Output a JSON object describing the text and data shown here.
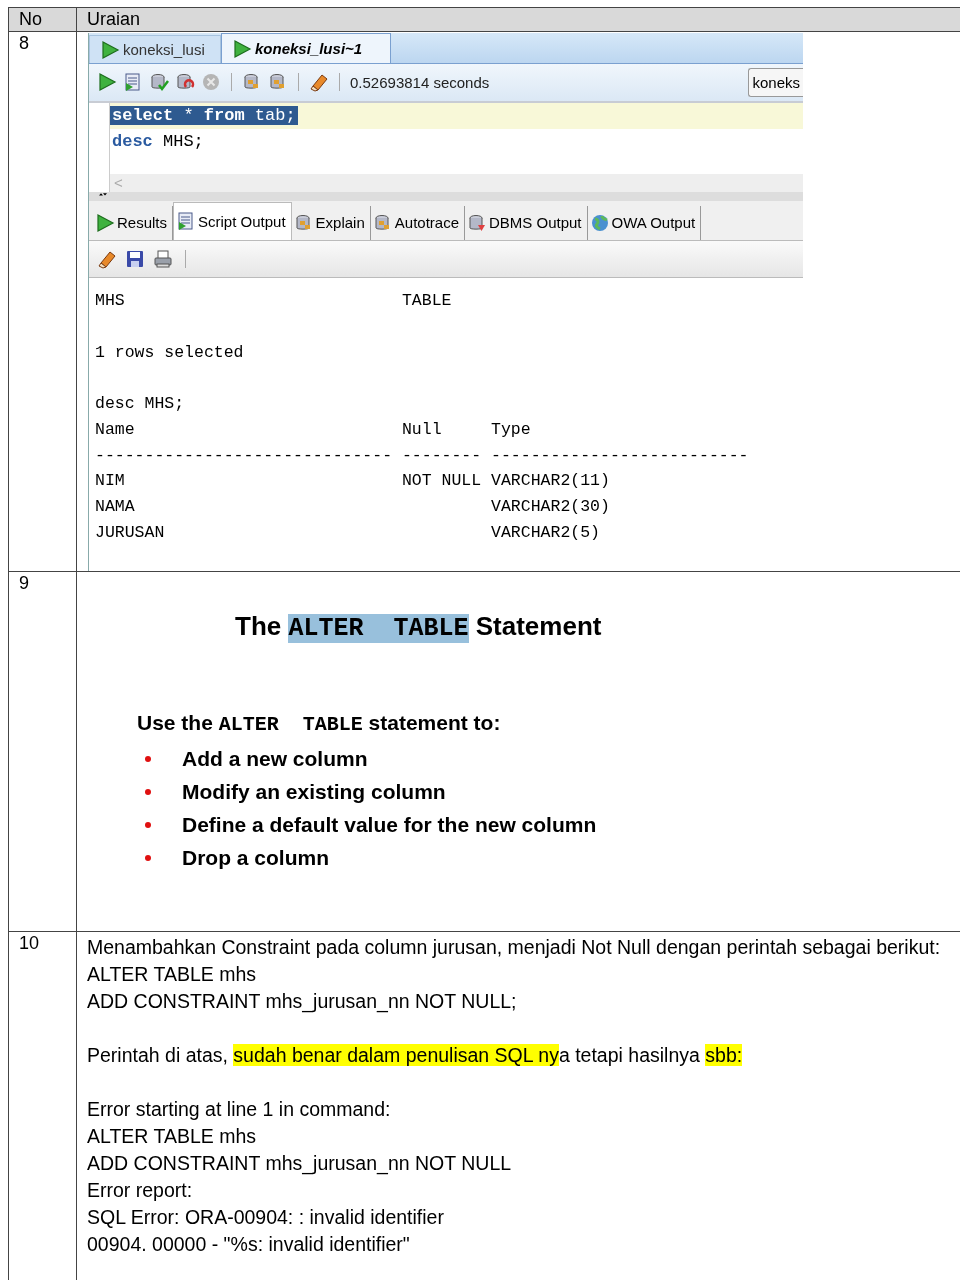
{
  "table": {
    "columns": [
      "No",
      "Uraian"
    ],
    "rows": [
      {
        "no": "8",
        "content": {
          "kind": "sql_developer",
          "doc_tabs": [
            {
              "label": "koneksi_lusi",
              "selected": false
            },
            {
              "label": "koneksi_lusi~1",
              "selected": true
            }
          ],
          "status": "0.52693814 seconds",
          "connection": "koneks",
          "editor_lines": [
            {
              "selected": true,
              "tokens": [
                {
                  "text": "select",
                  "kind": "keyword"
                },
                {
                  "text": " * ",
                  "kind": "plain"
                },
                {
                  "text": "from",
                  "kind": "keyword"
                },
                {
                  "text": " tab;",
                  "kind": "plain"
                }
              ]
            },
            {
              "selected": false,
              "tokens": [
                {
                  "text": "desc",
                  "kind": "keyword"
                },
                {
                  "text": " MHS;",
                  "kind": "plain"
                }
              ]
            }
          ],
          "scroll_glyph": "<",
          "output_tabs": [
            {
              "label": "Results",
              "selected": false
            },
            {
              "label": "Script Output",
              "selected": true
            },
            {
              "label": "Explain",
              "selected": false
            },
            {
              "label": "Autotrace",
              "selected": false
            },
            {
              "label": "DBMS Output",
              "selected": false
            },
            {
              "label": "OWA Output",
              "selected": false
            }
          ],
          "output_blocks": [
            [
              "MHS                            TABLE"
            ],
            [
              "1 rows selected"
            ],
            [
              "desc MHS;",
              "Name                           Null     Type",
              "------------------------------ -------- --------------------------",
              "NIM                            NOT NULL VARCHAR2(11)",
              "NAMA                                    VARCHAR2(30)",
              "JURUSAN                                 VARCHAR2(5)"
            ]
          ]
        }
      },
      {
        "no": "9",
        "content": {
          "kind": "slide",
          "title": {
            "before": "The",
            "code": "ALTER  TABLE",
            "after": "Statement"
          },
          "intro": {
            "before": "Use the",
            "code": "ALTER  TABLE",
            "after": "statement to:"
          },
          "bullets": [
            "Add a new column",
            "Modify an existing column",
            "Define a default value for the new column",
            "Drop a column"
          ]
        }
      },
      {
        "no": "10",
        "content": {
          "kind": "text",
          "blocks": [
            [
              "Menambahkan Constraint pada column jurusan, menjadi Not Null dengan perintah sebagai berikut:",
              "ALTER TABLE mhs",
              "ADD CONSTRAINT mhs_jurusan_nn NOT NULL;"
            ],
            [
              [
                {
                  "text": "Perintah di atas, ",
                  "highlighted": false
                },
                {
                  "text": "sudah benar dalam penulisan SQL ny",
                  "highlighted": true
                },
                {
                  "text": "a tetapi hasilnya ",
                  "highlighted": false
                },
                {
                  "text": "sbb:",
                  "highlighted": true
                }
              ]
            ],
            [
              "Error starting at line 1 in command:",
              "ALTER TABLE mhs",
              "ADD CONSTRAINT mhs_jurusan_nn NOT NULL",
              "Error report:",
              "SQL Error: ORA-00904: : invalid identifier",
              "00904. 00000 -  \"%s: invalid identifier\""
            ]
          ]
        }
      }
    ]
  }
}
